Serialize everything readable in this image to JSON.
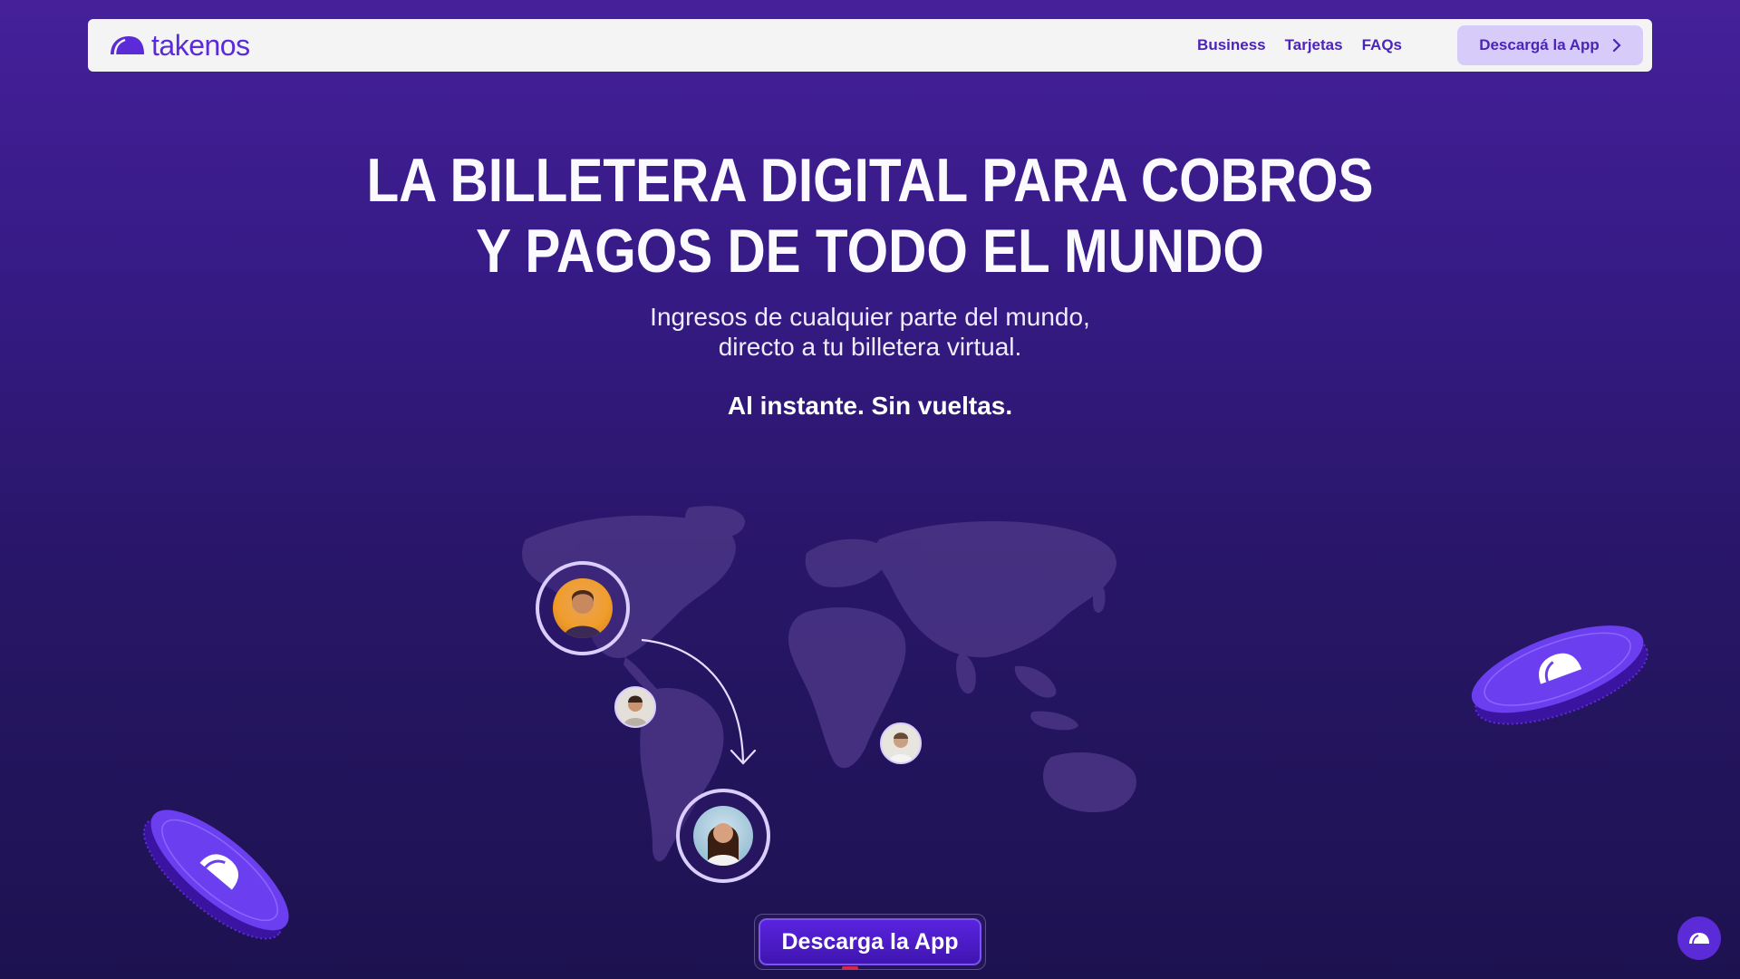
{
  "colors": {
    "accent": "#5a2bd6",
    "nav_link": "#4b24b8",
    "nav_cta_bg": "#d7ccf9",
    "background_top": "#45209a",
    "background_bottom": "#1d1250"
  },
  "navbar": {
    "logo_icon": "takenos-logo-icon",
    "brand": "takenos",
    "links": [
      "Business",
      "Tarjetas",
      "FAQs"
    ],
    "cta_label": "Descargá la App",
    "cta_icon": "chevron-right-icon"
  },
  "hero": {
    "title_line1": "LA BILLETERA DIGITAL PARA COBROS",
    "title_line2": "Y PAGOS DE TODO EL MUNDO",
    "subtitle_line1": "Ingresos de cualquier parte del mundo,",
    "subtitle_line2": "directo a tu billetera virtual.",
    "tagline": "Al instante. Sin vueltas."
  },
  "illustration": {
    "map": "world-map",
    "avatars": [
      "sender-avatar",
      "receiver-avatar",
      "user-avatar-americas",
      "user-avatar-africa"
    ],
    "arrow": "transfer-arrow"
  },
  "cta": {
    "download_label": "Descarga la App"
  },
  "chat": {
    "icon": "chat-widget-icon"
  }
}
